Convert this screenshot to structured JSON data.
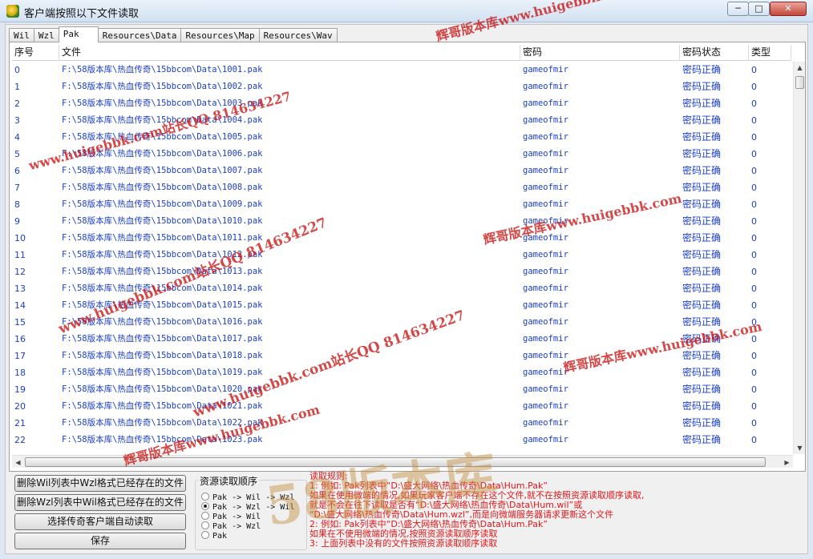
{
  "window": {
    "title": "客户端按照以下文件读取"
  },
  "tabs": [
    "Wil",
    "Wzl",
    "Pak",
    "Resources\\Data",
    "Resources\\Map",
    "Resources\\Wav"
  ],
  "list": {
    "headers": [
      "序号",
      "文件",
      "密码",
      "密码状态",
      "类型"
    ],
    "rows": [
      [
        "0",
        "F:\\58版本库\\热血传奇\\15bbcom\\Data\\1001.pak",
        "gameofmir",
        "密码正确",
        "0"
      ],
      [
        "1",
        "F:\\58版本库\\热血传奇\\15bbcom\\Data\\1002.pak",
        "gameofmir",
        "密码正确",
        "0"
      ],
      [
        "2",
        "F:\\58版本库\\热血传奇\\15bbcom\\Data\\1003.pak",
        "gameofmir",
        "密码正确",
        "0"
      ],
      [
        "3",
        "F:\\58版本库\\热血传奇\\15bbcom\\Data\\1004.pak",
        "gameofmir",
        "密码正确",
        "0"
      ],
      [
        "4",
        "F:\\58版本库\\热血传奇\\15bbcom\\Data\\1005.pak",
        "gameofmir",
        "密码正确",
        "0"
      ],
      [
        "5",
        "F:\\58版本库\\热血传奇\\15bbcom\\Data\\1006.pak",
        "gameofmir",
        "密码正确",
        "0"
      ],
      [
        "6",
        "F:\\58版本库\\热血传奇\\15bbcom\\Data\\1007.pak",
        "gameofmir",
        "密码正确",
        "0"
      ],
      [
        "7",
        "F:\\58版本库\\热血传奇\\15bbcom\\Data\\1008.pak",
        "gameofmir",
        "密码正确",
        "0"
      ],
      [
        "8",
        "F:\\58版本库\\热血传奇\\15bbcom\\Data\\1009.pak",
        "gameofmir",
        "密码正确",
        "0"
      ],
      [
        "9",
        "F:\\58版本库\\热血传奇\\15bbcom\\Data\\1010.pak",
        "gameofmir",
        "密码正确",
        "0"
      ],
      [
        "10",
        "F:\\58版本库\\热血传奇\\15bbcom\\Data\\1011.pak",
        "gameofmir",
        "密码正确",
        "0"
      ],
      [
        "11",
        "F:\\58版本库\\热血传奇\\15bbcom\\Data\\1012.pak",
        "gameofmir",
        "密码正确",
        "0"
      ],
      [
        "12",
        "F:\\58版本库\\热血传奇\\15bbcom\\Data\\1013.pak",
        "gameofmir",
        "密码正确",
        "0"
      ],
      [
        "13",
        "F:\\58版本库\\热血传奇\\15bbcom\\Data\\1014.pak",
        "gameofmir",
        "密码正确",
        "0"
      ],
      [
        "14",
        "F:\\58版本库\\热血传奇\\15bbcom\\Data\\1015.pak",
        "gameofmir",
        "密码正确",
        "0"
      ],
      [
        "15",
        "F:\\58版本库\\热血传奇\\15bbcom\\Data\\1016.pak",
        "gameofmir",
        "密码正确",
        "0"
      ],
      [
        "16",
        "F:\\58版本库\\热血传奇\\15bbcom\\Data\\1017.pak",
        "gameofmir",
        "密码正确",
        "0"
      ],
      [
        "17",
        "F:\\58版本库\\热血传奇\\15bbcom\\Data\\1018.pak",
        "gameofmir",
        "密码正确",
        "0"
      ],
      [
        "18",
        "F:\\58版本库\\热血传奇\\15bbcom\\Data\\1019.pak",
        "gameofmir",
        "密码正确",
        "0"
      ],
      [
        "19",
        "F:\\58版本库\\热血传奇\\15bbcom\\Data\\1020.pak",
        "gameofmir",
        "密码正确",
        "0"
      ],
      [
        "20",
        "F:\\58版本库\\热血传奇\\15bbcom\\Data\\1021.pak",
        "gameofmir",
        "密码正确",
        "0"
      ],
      [
        "21",
        "F:\\58版本库\\热血传奇\\15bbcom\\Data\\1022.pak",
        "gameofmir",
        "密码正确",
        "0"
      ],
      [
        "22",
        "F:\\58版本库\\热血传奇\\15bbcom\\Data\\1023.pak",
        "gameofmir",
        "密码正确",
        "0"
      ]
    ]
  },
  "buttons": {
    "delete_wil": "删除Wil列表中Wzl格式已经存在的文件",
    "delete_wzl": "删除Wzl列表中Wil格式已经存在的文件",
    "select_client": "选择传奇客户端自动读取",
    "save": "保存"
  },
  "read_order": {
    "title": "资源读取顺序",
    "options": [
      "Pak -> Wil -> Wzl",
      "Pak -> Wzl -> Wil",
      "Pak -> Wil",
      "Pak -> Wzl",
      "Pak"
    ],
    "selected_index": 1
  },
  "rules": [
    "读取规则:",
    "1: 例如: Pak列表中“D:\\盛大网络\\热血传奇\\Data\\Hum.Pak”",
    "   如果在使用微端的情况,如果玩家客户端不存在这个文件,就不在按照资源读取顺序读取,",
    "   就是不会在往下读取是否有“D:\\盛大网络\\热血传奇\\Data\\Hum.wil”或",
    "   “D:\\盛大网络\\热血传奇\\Data\\Hum.wzl”,而是向微端服务器请求更新这个文件",
    "2: 例如: Pak列表中“D:\\盛大网络\\热血传奇\\Data\\Hum.Pak”",
    "   如果在不使用微端的情况,按照资源读取顺序读取",
    "3: 上面列表中没有的文件按照资源读取顺序读取"
  ],
  "watermarks": {
    "site": "辉哥版本库www.huigebbk.com",
    "qq": "www.huigebbk.com站长QQ 814634227",
    "brand": "58版本库"
  },
  "colors": {
    "link_blue": "#1b3fc4",
    "rule_red": "#e0181b"
  }
}
